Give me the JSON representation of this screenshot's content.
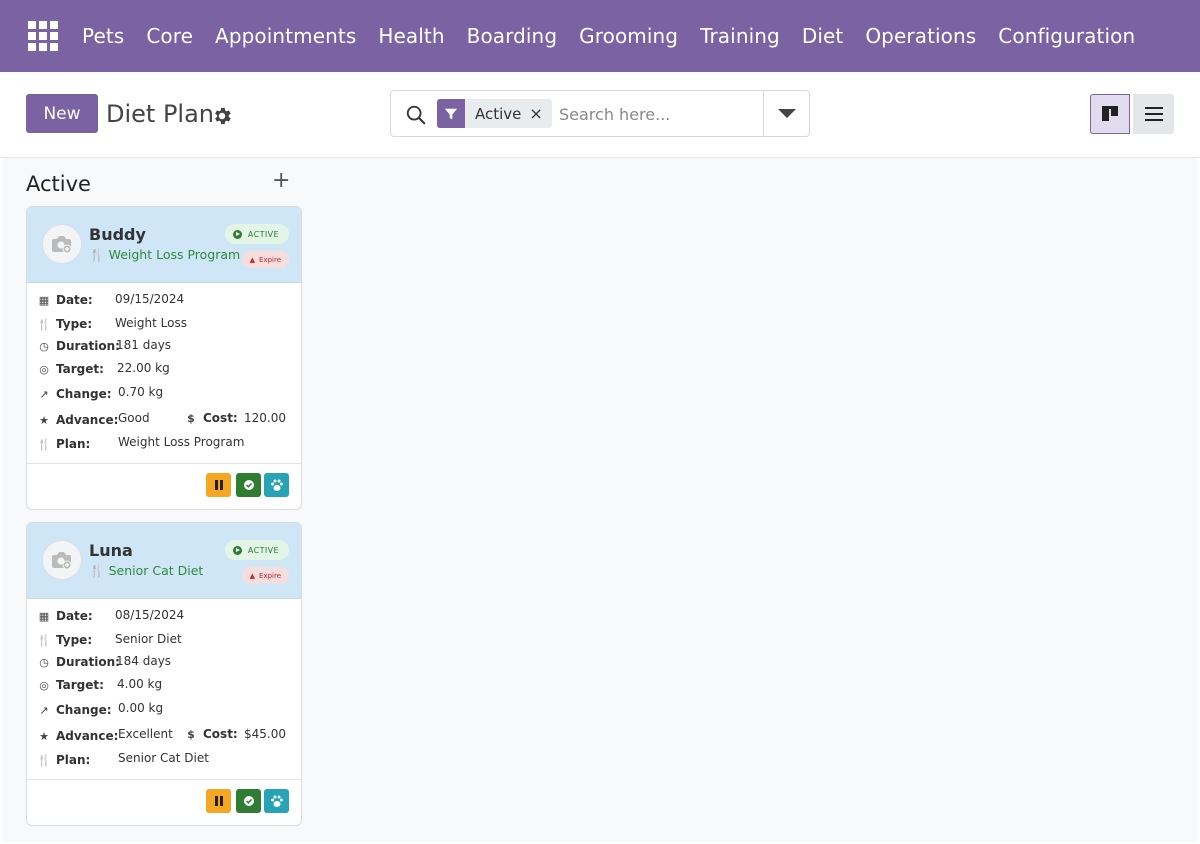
{
  "nav": {
    "items": [
      "Pets",
      "Core",
      "Appointments",
      "Health",
      "Boarding",
      "Grooming",
      "Training",
      "Diet",
      "Operations",
      "Configuration"
    ]
  },
  "control": {
    "new_label": "New",
    "title": "Diet Plan"
  },
  "search": {
    "facet": "Active",
    "remove": "×",
    "placeholder": "Search here..."
  },
  "column": {
    "title": "Active",
    "add": "+"
  },
  "labels": {
    "date": "Date:",
    "type": "Type:",
    "duration": "Duration:",
    "target": "Target:",
    "change": "Change:",
    "advance": "Advance:",
    "cost": "Cost:",
    "plan": "Plan:",
    "active_badge": "ACTIVE",
    "expire_badge": "Expire"
  },
  "cards": [
    {
      "name": "Buddy",
      "plan_title": "Weight Loss Program",
      "date": "09/15/2024",
      "type": "Weight Loss",
      "duration": "181 days",
      "target": "22.00 kg",
      "change": "0.70 kg",
      "advance": "Good",
      "cost": "120.00",
      "plan": "Weight Loss Program"
    },
    {
      "name": "Luna",
      "plan_title": "Senior Cat Diet",
      "date": "08/15/2024",
      "type": "Senior Diet",
      "duration": "184 days",
      "target": "4.00 kg",
      "change": "0.00 kg",
      "advance": "Excellent",
      "cost": "$45.00",
      "plan": "Senior Cat Diet"
    }
  ],
  "colors": {
    "brand": "#7a62a3",
    "card_header": "#cfe6f7",
    "pause": "#f5a623",
    "done": "#2e7d32",
    "pet": "#26a3b5"
  }
}
